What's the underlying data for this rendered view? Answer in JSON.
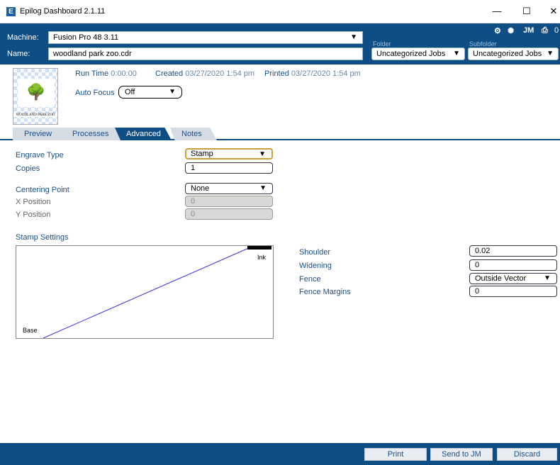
{
  "window": {
    "title": "Epilog Dashboard 2.1.11",
    "app_icon": "E",
    "minimize": "—",
    "maximize": "☐",
    "close": "✕"
  },
  "header": {
    "machine_label": "Machine:",
    "machine_value": "Fusion Pro 48 3.11",
    "name_label": "Name:",
    "name_value": "woodland park zoo.cdr",
    "folder_caption": "Folder",
    "subfolder_caption": "Subfolder",
    "folder_value": "Uncategorized Jobs",
    "subfolder_value": "Uncategorized Jobs",
    "jm_label": "JM",
    "count": "0"
  },
  "job": {
    "thumb_caption": "WOODLAND PARK ZOO",
    "run_time_label": "Run Time",
    "run_time_value": "0:00:00",
    "created_label": "Created",
    "created_value": "03/27/2020 1:54 pm",
    "printed_label": "Printed",
    "printed_value": "03/27/2020 1:54 pm",
    "auto_focus_label": "Auto Focus",
    "auto_focus_value": "Off"
  },
  "tabs": [
    "Preview",
    "Processes",
    "Advanced",
    "Notes"
  ],
  "active_tab": "Advanced",
  "form": {
    "engrave_type_label": "Engrave Type",
    "engrave_type_value": "Stamp",
    "copies_label": "Copies",
    "copies_value": "1",
    "centering_label": "Centering Point",
    "centering_value": "None",
    "x_label": "X Position",
    "x_value": "0",
    "y_label": "Y Position",
    "y_value": "0"
  },
  "stamp": {
    "section_title": "Stamp Settings",
    "ink_label": "Ink",
    "base_label": "Base",
    "shoulder_label": "Shoulder",
    "shoulder_value": "0.02",
    "widening_label": "Widening",
    "widening_value": "0",
    "fence_label": "Fence",
    "fence_value": "Outside Vector",
    "fence_margins_label": "Fence Margins",
    "fence_margins_value": "0"
  },
  "footer": {
    "print": "Print",
    "send_to_jm": "Send to JM",
    "discard": "Discard"
  },
  "colors": {
    "brand": "#0f4e85",
    "label": "#1b4f8a",
    "curve": "#3a2fd8"
  }
}
